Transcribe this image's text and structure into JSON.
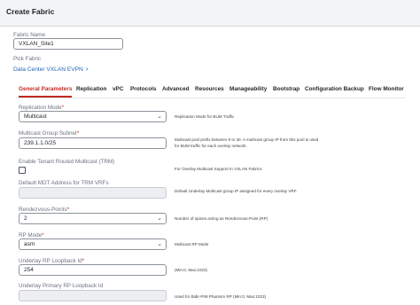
{
  "window": {
    "title": "Create Fabric"
  },
  "fabric_name": {
    "label": "Fabric Name",
    "value": "VXLAN_Site1"
  },
  "pick_fabric": {
    "label": "Pick Fabric",
    "link": "Data Center VXLAN EVPN"
  },
  "tabs": [
    {
      "label": "General Parameters",
      "active": true
    },
    {
      "label": "Replication",
      "active": false
    },
    {
      "label": "vPC",
      "active": false
    },
    {
      "label": "Protocols",
      "active": false
    },
    {
      "label": "Advanced",
      "active": false
    },
    {
      "label": "Resources",
      "active": false
    },
    {
      "label": "Manageability",
      "active": false
    },
    {
      "label": "Bootstrap",
      "active": false
    },
    {
      "label": "Configuration Backup",
      "active": false
    },
    {
      "label": "Flow Monitor",
      "active": false
    }
  ],
  "fields": {
    "replication_mode": {
      "label": "Replication Mode",
      "value": "Multicast",
      "help": "Replication Mode for BUM Traffic"
    },
    "multicast_subnet": {
      "label": "Multicast Group Subnet",
      "value": "239.1.1.0/25",
      "help1": "Multicast pool prefix between 8 to 30. A multicast group IP from this pool is used",
      "help2": "for BUM traffic for each overlay network."
    },
    "trm": {
      "label": "Enable Tenant Routed Multicast (TRM)",
      "checked": false,
      "help": "For Overlay Multicast Support In VXLAN Fabrics"
    },
    "mdt_address": {
      "label": "Default MDT Address for TRM VRFs",
      "value": "",
      "help": "Default Underlay Multicast group IP assigned for every overlay VRF."
    },
    "rendezvous_points": {
      "label": "Rendezvous-Points",
      "value": "2",
      "help": "Number of spines acting as Rendezvous-Point (RP)"
    },
    "rp_mode": {
      "label": "RP Mode",
      "value": "asm",
      "help": "Multicast RP Mode"
    },
    "underlay_rp_loopback": {
      "label": "Underlay RP Loopback Id",
      "value": "254",
      "help": "(Min:0, Max:1023)"
    },
    "underlay_primary_rp_loopback": {
      "label": "Underlay Primary RP Loopback Id",
      "value": "",
      "help": "Used for Bidir-PIM Phantom RP (Min:0, Max:1023)"
    }
  },
  "required_mark": "*",
  "icons": {
    "dropdown": "chevron-down-icon",
    "link_arrow": "chevron-right-icon"
  },
  "colors": {
    "accent": "#c02a1f",
    "link": "#1e63b8"
  }
}
